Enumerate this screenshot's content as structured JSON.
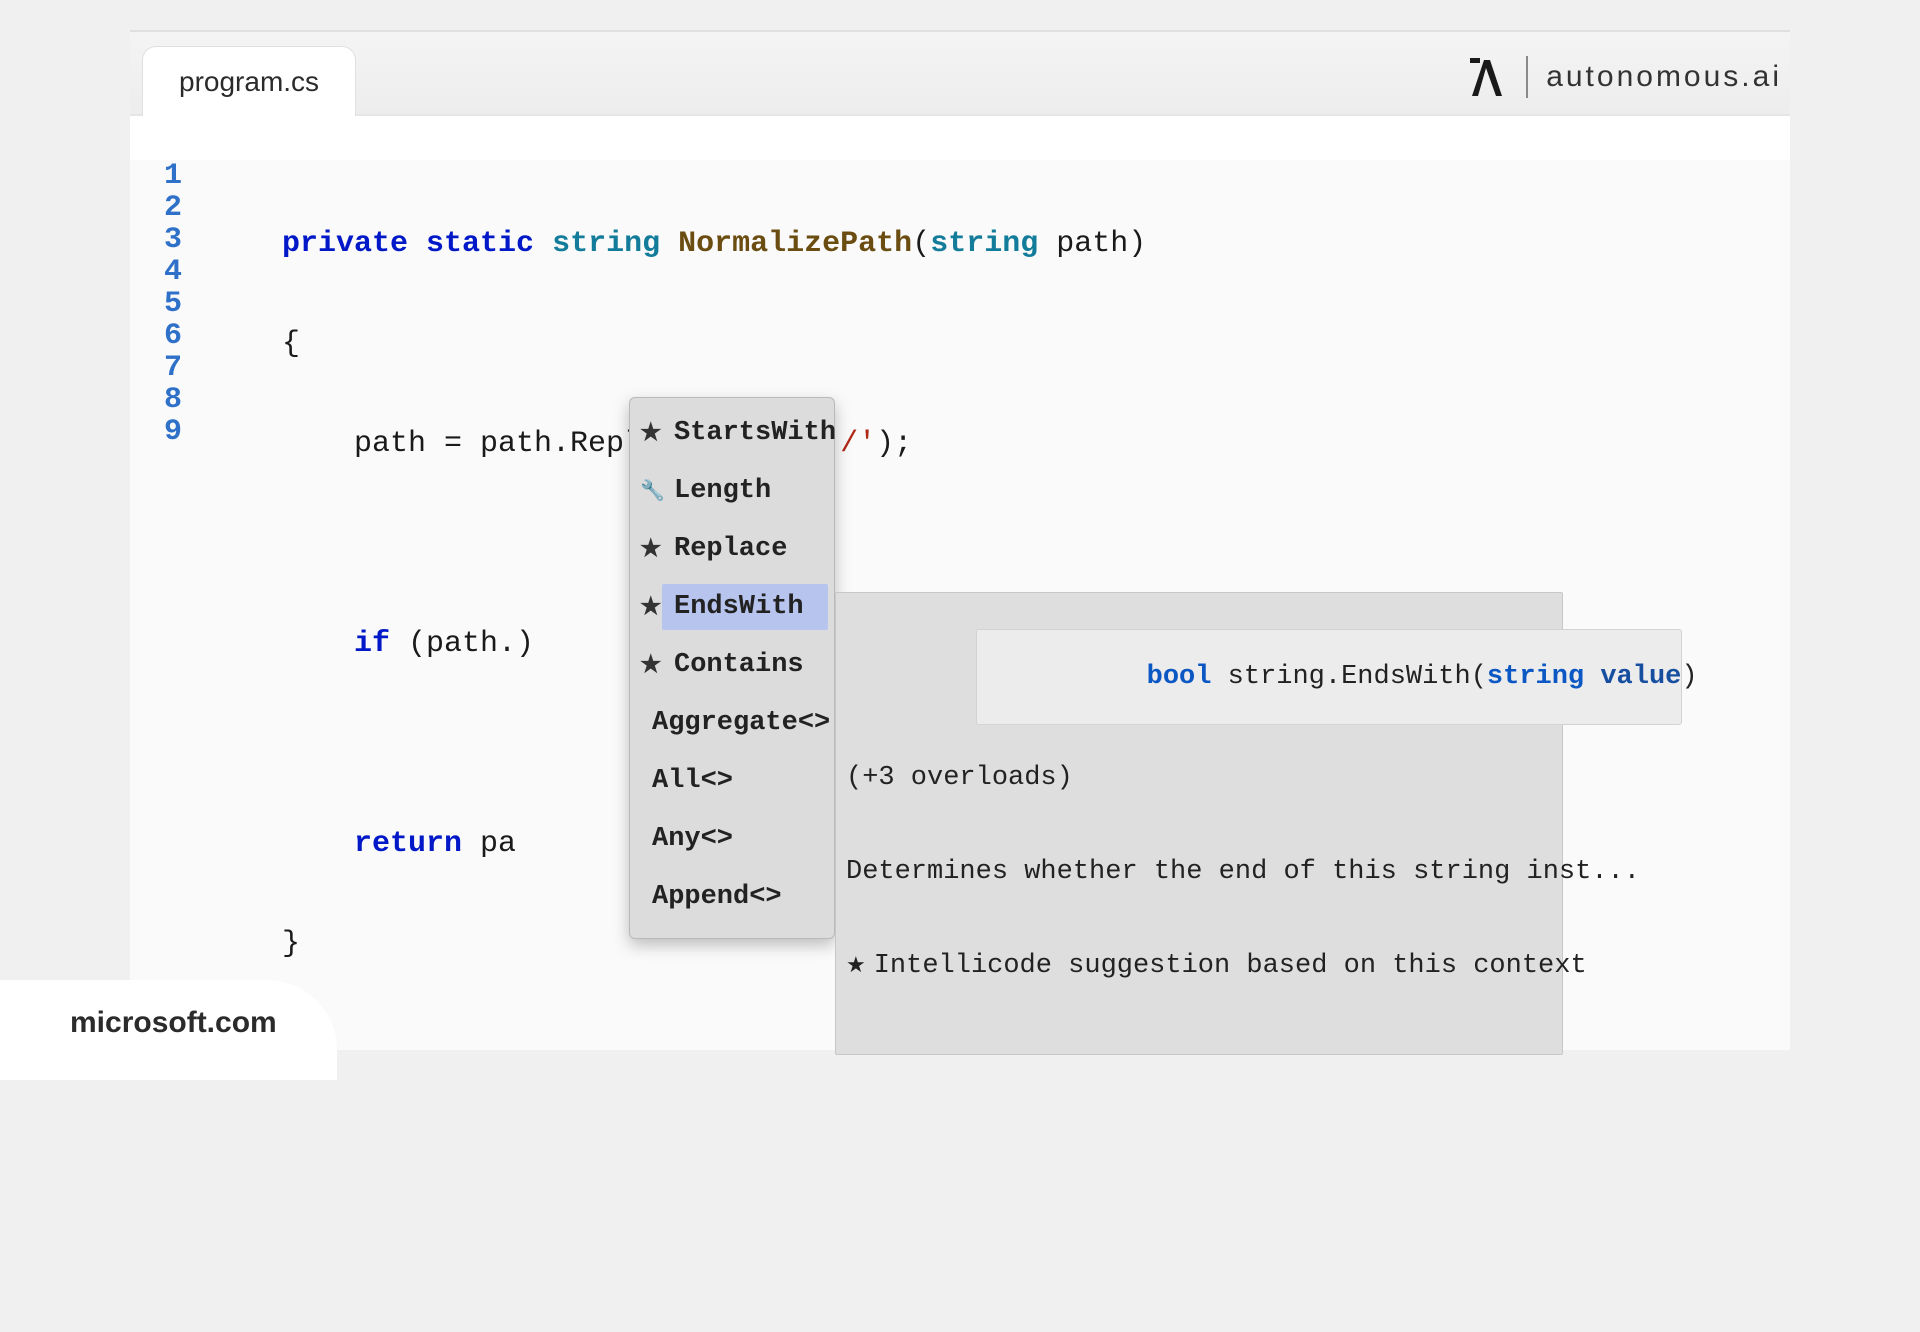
{
  "tab": {
    "filename": "program.cs"
  },
  "brand": {
    "text": "autonomous.ai"
  },
  "gutter": {
    "lines": [
      "1",
      "2",
      "3",
      "4",
      "5",
      "6",
      "7",
      "8",
      "9"
    ]
  },
  "code": {
    "l1": {
      "kw1": "private",
      "kw2": "static",
      "type1": "string",
      "fn": "NormalizePath",
      "p_open": "(",
      "type2": "string",
      "param": " path)",
      "brace": ""
    },
    "l2": "{",
    "l3": {
      "pre": "    path = path.Replace(",
      "s1": "'\\\\'",
      "mid": ", ",
      "s2": "'/'",
      "post": ");"
    },
    "l4": "",
    "l5": {
      "kw": "if",
      "rest": " (path.)"
    },
    "l6": "",
    "l7": {
      "kw": "return",
      "rest": " pa"
    },
    "l8": "}",
    "l9": ""
  },
  "popup": {
    "items": [
      {
        "icon": "star",
        "label": "StartsWith",
        "selected": false
      },
      {
        "icon": "wrench",
        "label": "Length",
        "selected": false
      },
      {
        "icon": "star",
        "label": "Replace",
        "selected": false
      },
      {
        "icon": "star",
        "label": "EndsWith",
        "selected": true
      },
      {
        "icon": "star",
        "label": "Contains",
        "selected": false
      },
      {
        "icon": "",
        "label": "Aggregate<>",
        "selected": false
      },
      {
        "icon": "",
        "label": "All<>",
        "selected": false
      },
      {
        "icon": "",
        "label": "Any<>",
        "selected": false
      },
      {
        "icon": "",
        "label": "Append<>",
        "selected": false
      }
    ]
  },
  "tooltip": {
    "sig_bool": "bool",
    "sig_mid": " string.EndsWith(",
    "sig_ptype": "string",
    "sig_pname": " value",
    "sig_close": ")",
    "overloads": "(+3 overloads)",
    "desc": "Determines whether the end of this string inst...",
    "intelli": "Intellicode suggestion based on this context"
  },
  "footer": {
    "source": "microsoft.com"
  }
}
